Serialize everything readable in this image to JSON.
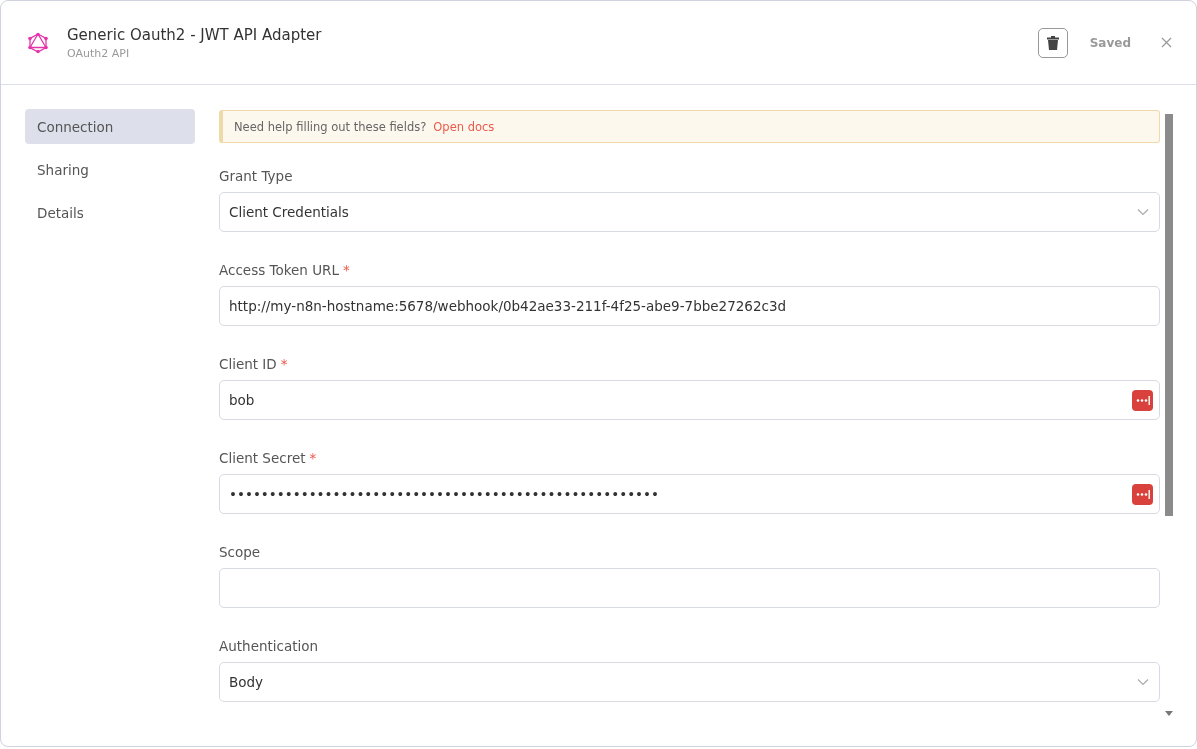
{
  "header": {
    "title": "Generic Oauth2 - JWT API Adapter",
    "subtitle": "OAuth2 API",
    "status": "Saved"
  },
  "sidebar": {
    "items": [
      {
        "label": "Connection",
        "selected": true
      },
      {
        "label": "Sharing",
        "selected": false
      },
      {
        "label": "Details",
        "selected": false
      }
    ]
  },
  "notice": {
    "text": "Need help filling out these fields?",
    "link": "Open docs"
  },
  "fields": [
    {
      "label": "Grant Type",
      "kind": "select",
      "value": "Client Credentials"
    },
    {
      "label": "Access Token URL",
      "required_mark": "*",
      "kind": "text",
      "value": "http://my-n8n-hostname:5678/webhook/0b42ae33-211f-4f25-abe9-7bbe27262c3d"
    },
    {
      "label": "Client ID",
      "required_mark": "*",
      "kind": "secret",
      "value": "bob"
    },
    {
      "label": "Client Secret",
      "required_mark": "*",
      "kind": "secret",
      "value": "••••••••••••••••••••••••••••••••••••••••••••••••••••••"
    },
    {
      "label": "Scope",
      "kind": "text"
    },
    {
      "label": "Authentication",
      "kind": "select",
      "value": "Body"
    }
  ]
}
